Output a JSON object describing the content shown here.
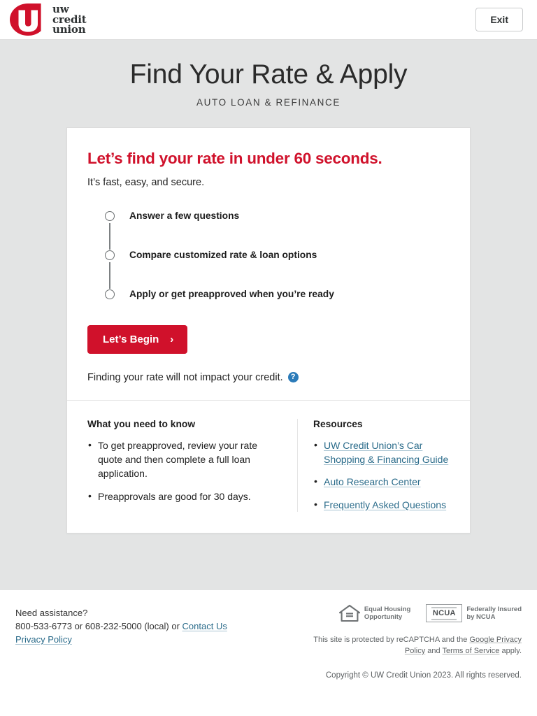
{
  "header": {
    "logo_name": "uw-credit-union-logo",
    "brand_line1": "uw",
    "brand_line2": "credit",
    "brand_line3": "union",
    "exit_label": "Exit"
  },
  "hero": {
    "title": "Find Your Rate & Apply",
    "subtitle": "AUTO LOAN & REFINANCE"
  },
  "card": {
    "heading": "Let’s find your rate in under 60 seconds.",
    "subheading": "It’s fast, easy, and secure.",
    "steps": [
      {
        "label": "Answer a few questions"
      },
      {
        "label": "Compare customized rate & loan options"
      },
      {
        "label": "Apply or get preapproved when you’re ready"
      }
    ],
    "cta_label": "Let’s Begin",
    "cta_arrow": "›",
    "disclaimer": "Finding your rate will not impact your credit.",
    "help_glyph": "?",
    "need_to_know": {
      "title": "What you need to know",
      "items": [
        "To get preapproved, review your rate quote and then complete a full loan application.",
        "Preapprovals are good for 30 days."
      ]
    },
    "resources": {
      "title": "Resources",
      "links": [
        "UW Credit Union’s Car Shopping & Financing Guide",
        "Auto Research Center",
        "Frequently Asked Questions"
      ]
    }
  },
  "footer": {
    "need_assistance": "Need assistance?",
    "phone_primary": "800-533-6773",
    "or_1": " or ",
    "phone_local": "608-232-5000 (local)",
    "or_2": " or ",
    "contact_us": "Contact Us",
    "privacy_policy": "Privacy Policy",
    "equal_housing_line1": "Equal Housing",
    "equal_housing_line2": "Opportunity",
    "ncua_word": "NCUA",
    "ncua_line1": "Federally Insured",
    "ncua_line2": "by NCUA",
    "recaptcha_prefix": "This site is protected by reCAPTCHA and the ",
    "recaptcha_link1": "Google Privacy Policy",
    "recaptcha_mid": " and ",
    "recaptcha_link2": "Terms of Service",
    "recaptcha_suffix": " apply.",
    "copyright": "Copyright © UW Credit Union 2023. All rights reserved."
  },
  "colors": {
    "brand_red": "#d0112b",
    "link_blue": "#2a6b8a",
    "help_blue": "#2b7bb9",
    "page_gray": "#e3e4e4"
  }
}
